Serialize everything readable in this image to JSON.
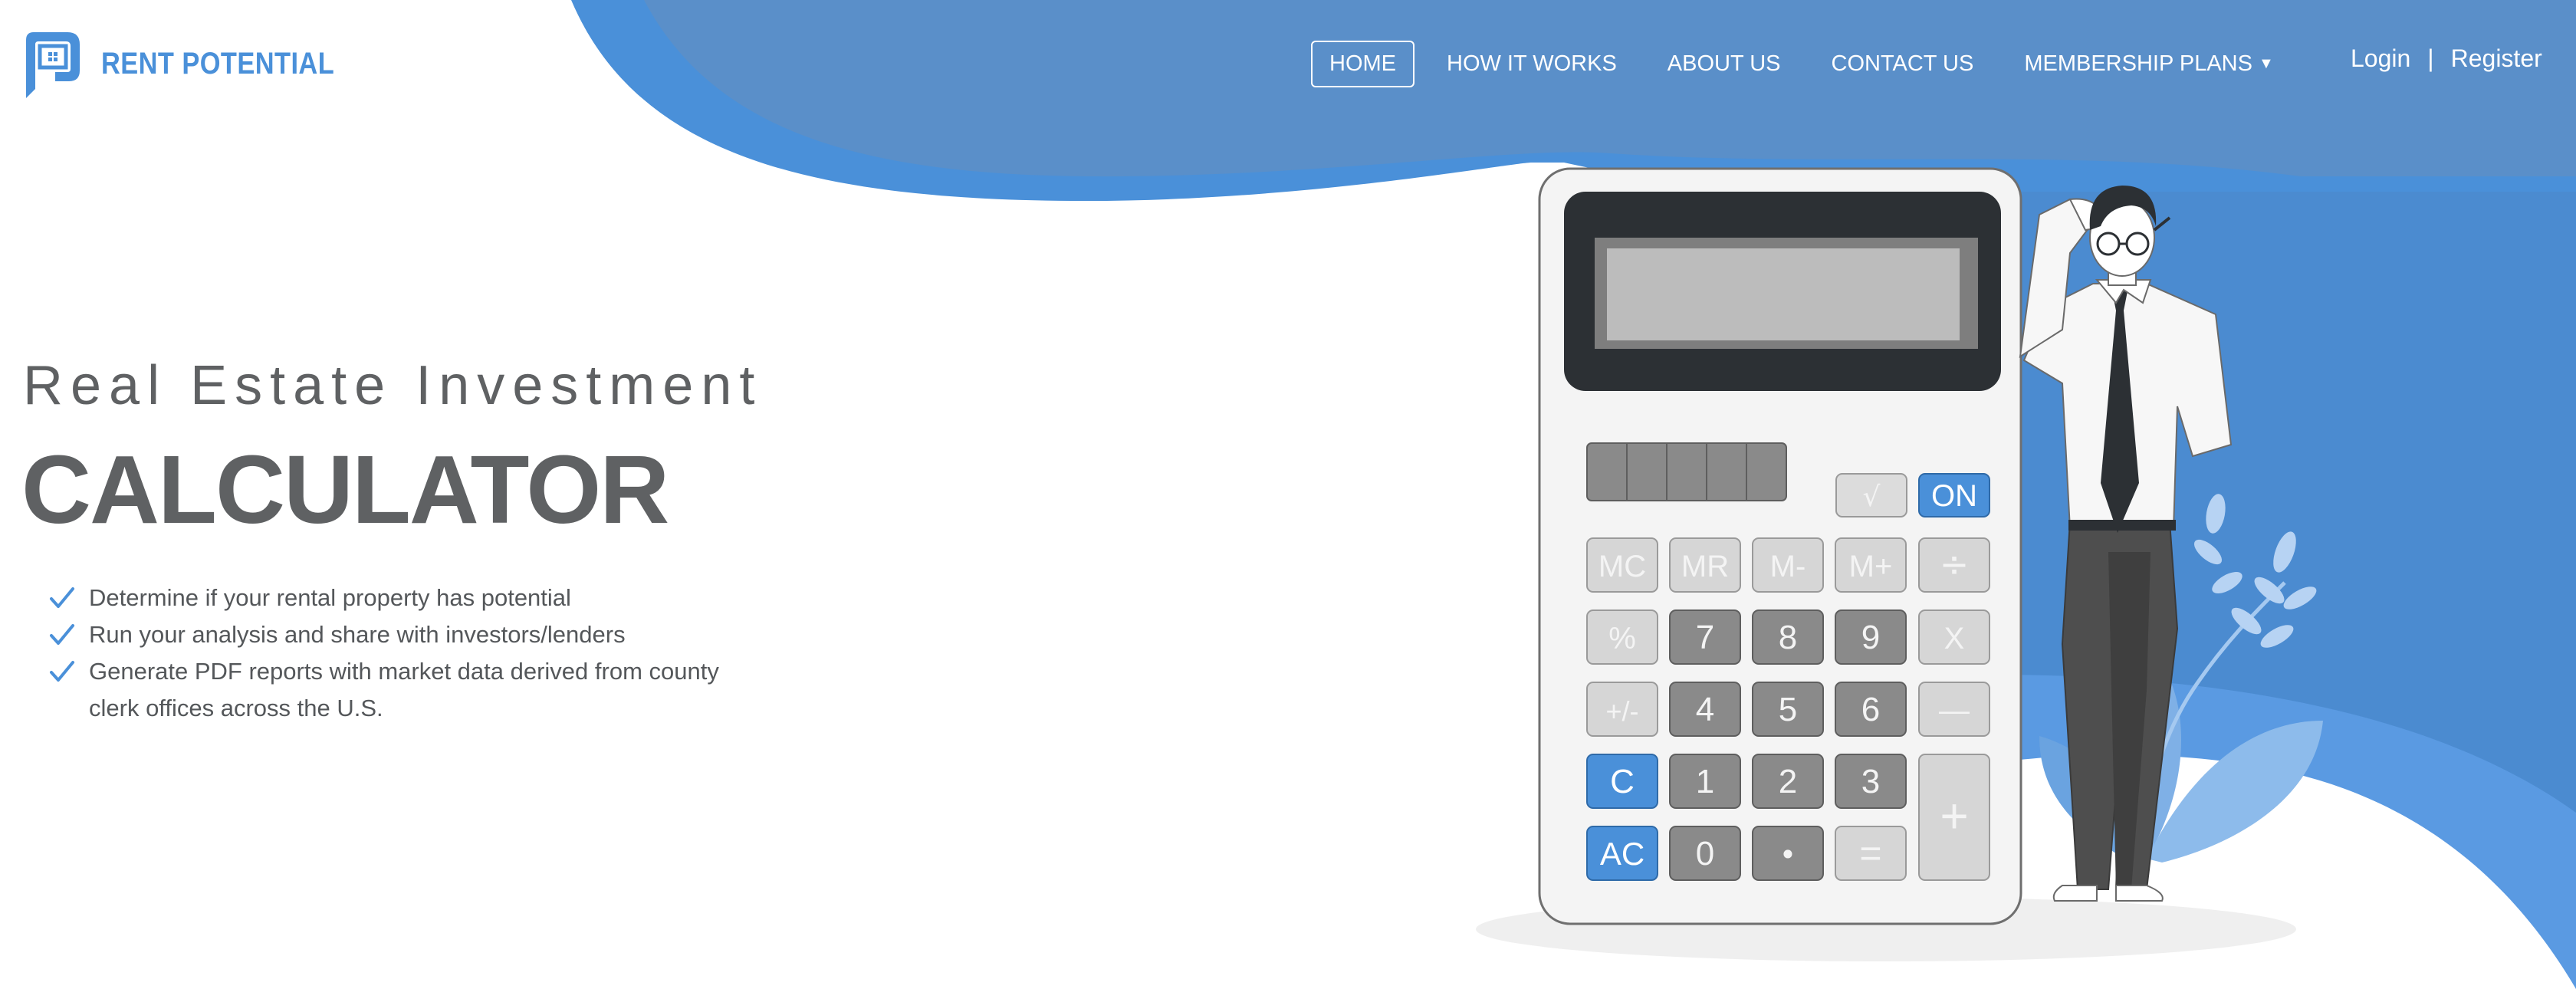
{
  "brand": {
    "name": "RENT POTENTIAL",
    "primary_color": "#4a90d9",
    "text_color": "#5f6163"
  },
  "nav": {
    "items": [
      {
        "label": "HOME",
        "active": true
      },
      {
        "label": "HOW IT WORKS",
        "active": false
      },
      {
        "label": "ABOUT US",
        "active": false
      },
      {
        "label": "CONTACT US",
        "active": false
      },
      {
        "label": "MEMBERSHIP PLANS",
        "active": false,
        "dropdown": true
      }
    ],
    "login": "Login",
    "separator": "|",
    "register": "Register"
  },
  "hero": {
    "subtitle": "Real Estate Investment",
    "title": "CALCULATOR",
    "features": [
      "Determine if your rental property has potential",
      "Run your analysis and share with investors/lenders",
      "Generate PDF reports with market data derived from county clerk offices across the U.S."
    ]
  },
  "calculator": {
    "keys": {
      "sqrt": "√",
      "on": "ON",
      "mc": "MC",
      "mr": "MR",
      "m_minus": "M-",
      "m_plus": "M+",
      "divide": "÷",
      "percent": "%",
      "seven": "7",
      "eight": "8",
      "nine": "9",
      "multiply": "X",
      "plus_minus": "+/-",
      "four": "4",
      "five": "5",
      "six": "6",
      "minus": "—",
      "clear": "C",
      "one": "1",
      "two": "2",
      "three": "3",
      "plus": "+",
      "all_clear": "AC",
      "zero": "0",
      "dot": "•",
      "equals": "="
    }
  }
}
